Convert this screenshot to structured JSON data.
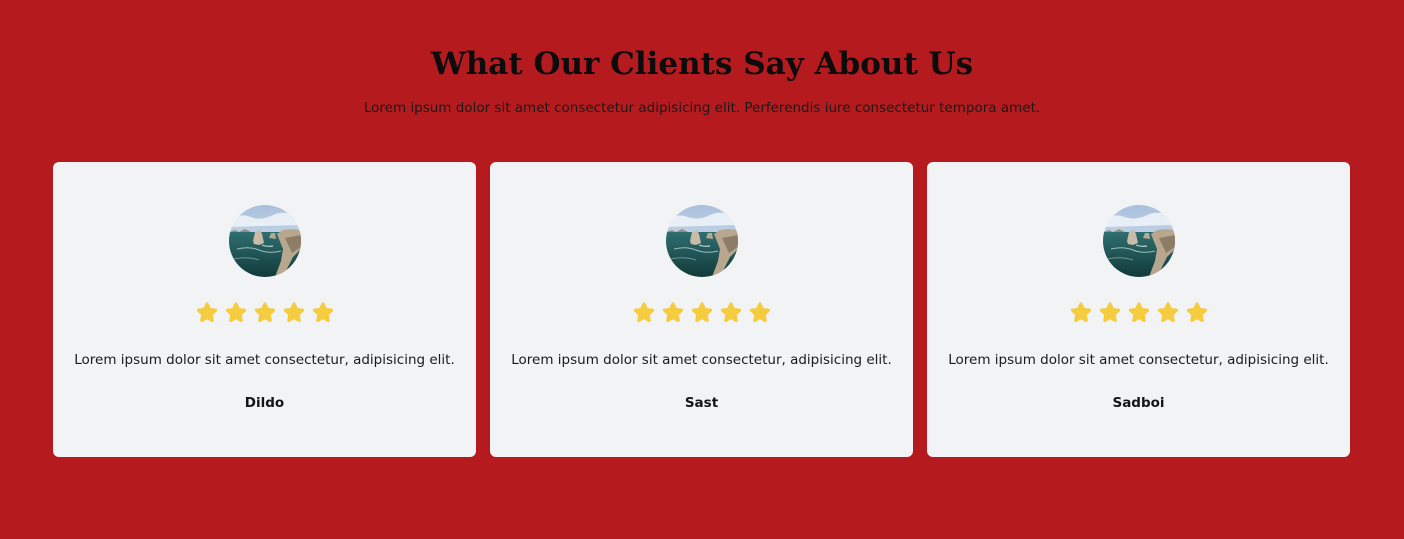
{
  "section": {
    "title": "What Our Clients Say About Us",
    "subtitle": "Lorem ipsum dolor sit amet consectetur adipisicing elit. Perferendis iure consectetur tempora amet."
  },
  "testimonials": [
    {
      "avatar_icon": "coastal-cliffs-photo",
      "rating": 5,
      "quote": "Lorem ipsum dolor sit amet consectetur, adipisicing elit.",
      "name": "Dildo"
    },
    {
      "avatar_icon": "coastal-cliffs-photo",
      "rating": 5,
      "quote": "Lorem ipsum dolor sit amet consectetur, adipisicing elit.",
      "name": "Sast"
    },
    {
      "avatar_icon": "coastal-cliffs-photo",
      "rating": 5,
      "quote": "Lorem ipsum dolor sit amet consectetur, adipisicing elit.",
      "name": "Sadboi"
    }
  ],
  "colors": {
    "background": "#b51b1e",
    "card": "#f2f3f5",
    "star": "#f5cc3f"
  }
}
